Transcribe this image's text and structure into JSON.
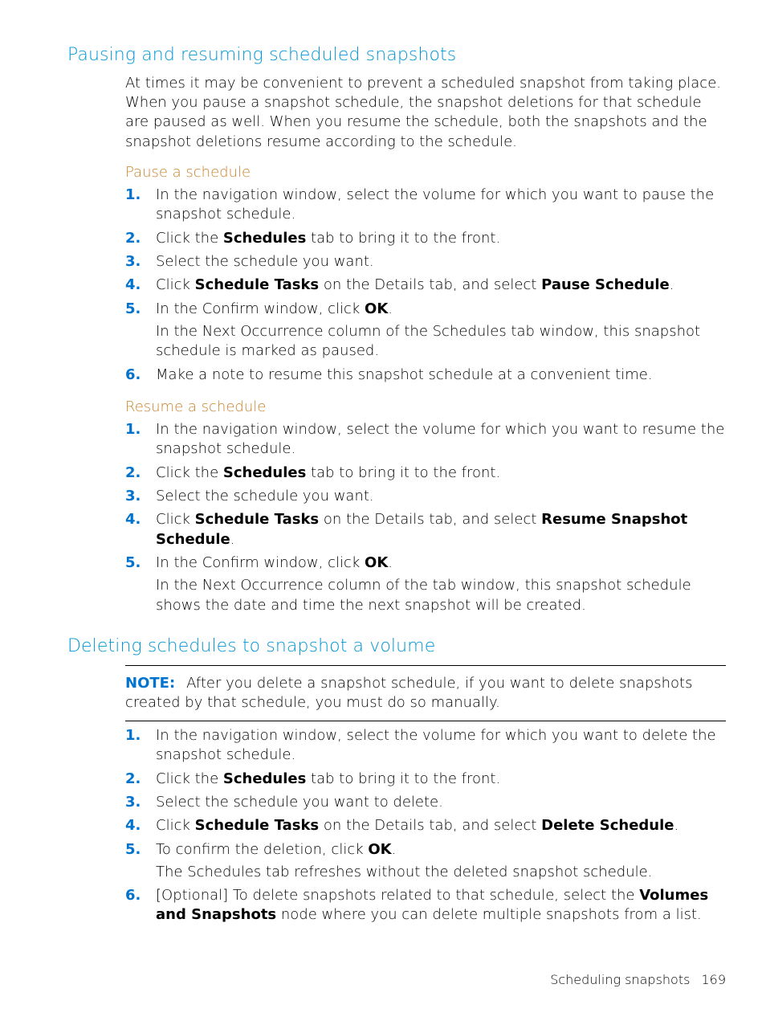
{
  "section1": {
    "heading": "Pausing and resuming scheduled snapshots",
    "intro": "At times it may be convenient to prevent a scheduled snapshot from taking place. When you pause a snapshot schedule, the snapshot deletions for that schedule are paused as well. When you resume the schedule, both the snapshots and the snapshot deletions resume according to the schedule.",
    "sub1": {
      "heading": "Pause a schedule",
      "li1": "In the navigation window, select the volume for which you want to pause the snapshot schedule.",
      "li2a": "Click the ",
      "li2b": "Schedules",
      "li2c": " tab to bring it to the front.",
      "li3": "Select the schedule you want.",
      "li4a": "Click ",
      "li4b": "Schedule Tasks",
      "li4c": " on the Details tab, and select ",
      "li4d": "Pause Schedule",
      "li4e": ".",
      "li5a": "In the Confirm window, click ",
      "li5b": "OK",
      "li5c": ".",
      "li5follow": "In the Next Occurrence column of the Schedules tab window, this snapshot schedule is marked as paused.",
      "li6": "Make a note to resume this snapshot schedule at a convenient time."
    },
    "sub2": {
      "heading": "Resume a schedule",
      "li1": "In the navigation window, select the volume for which you want to resume the snapshot schedule.",
      "li2a": "Click the ",
      "li2b": "Schedules",
      "li2c": " tab to bring it to the front.",
      "li3": "Select the schedule you want.",
      "li4a": "Click ",
      "li4b": "Schedule Tasks",
      "li4c": " on the Details tab, and select ",
      "li4d": "Resume Snapshot Schedule",
      "li4e": ".",
      "li5a": "In the Confirm window, click ",
      "li5b": "OK",
      "li5c": ".",
      "li5follow": "In the Next Occurrence column of the tab window, this snapshot schedule shows the date and time the next snapshot will be created."
    }
  },
  "section2": {
    "heading": "Deleting schedules to snapshot a volume",
    "noteLabel": "NOTE:",
    "noteText": "After you delete a snapshot schedule, if you want to delete snapshots created by that schedule, you must do so manually.",
    "li1": "In the navigation window, select the volume for which you want to delete the snapshot schedule.",
    "li2a": "Click the ",
    "li2b": "Schedules",
    "li2c": " tab to bring it to the front.",
    "li3": "Select the schedule you want to delete.",
    "li4a": "Click ",
    "li4b": "Schedule Tasks",
    "li4c": " on the Details tab, and select ",
    "li4d": "Delete Schedule",
    "li4e": ".",
    "li5a": "To confirm the deletion, click ",
    "li5b": "OK",
    "li5c": ".",
    "li5follow": "The Schedules tab refreshes without the deleted snapshot schedule.",
    "li6a": "[Optional] To delete snapshots related to that schedule, select the ",
    "li6b": "Volumes and Snapshots",
    "li6c": " node where you can delete multiple snapshots from a list."
  },
  "footer": {
    "section": "Scheduling snapshots",
    "page": "169"
  }
}
